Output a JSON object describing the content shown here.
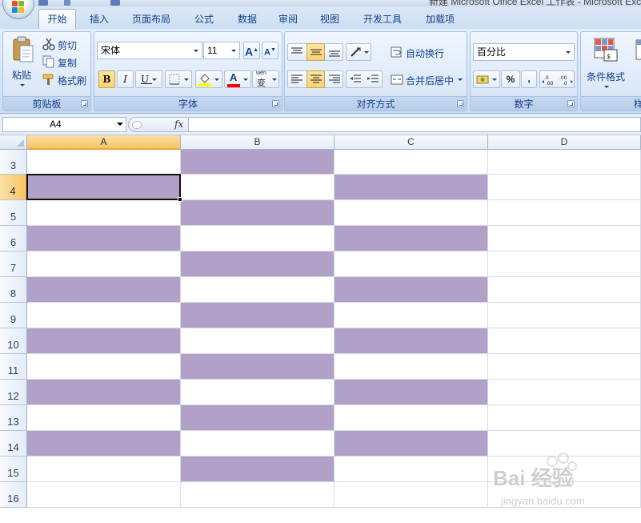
{
  "window": {
    "title": "新建 Microsoft Office Excel 工作表 - Microsoft Excel"
  },
  "tabs": [
    {
      "label": "开始",
      "active": true
    },
    {
      "label": "插入",
      "active": false
    },
    {
      "label": "页面布局",
      "active": false
    },
    {
      "label": "公式",
      "active": false
    },
    {
      "label": "数据",
      "active": false
    },
    {
      "label": "审阅",
      "active": false
    },
    {
      "label": "视图",
      "active": false
    },
    {
      "label": "开发工具",
      "active": false
    },
    {
      "label": "加载项",
      "active": false
    }
  ],
  "clipboard": {
    "paste": "粘贴",
    "cut": "剪切",
    "copy": "复制",
    "format_painter": "格式刷",
    "label": "剪贴板"
  },
  "font": {
    "name": "宋体",
    "size": "11",
    "grow": "A",
    "shrink": "A",
    "bold": "B",
    "italic": "I",
    "underline": "U",
    "font_color_letter": "A",
    "phonetic_letters": "wén",
    "phonetic_char": "变",
    "label": "字体"
  },
  "alignment": {
    "wrap_text": "自动换行",
    "merge_center": "合并后居中",
    "label": "对齐方式"
  },
  "number": {
    "format": "百分比",
    "percent": "%",
    "comma": ",",
    "label": "数字"
  },
  "styles": {
    "conditional": "条件格式",
    "table_partial": "表",
    "group_partial": "样"
  },
  "formula_bar": {
    "name_box": "A4",
    "fx": "fx",
    "value": ""
  },
  "sheet": {
    "columns": [
      "A",
      "B",
      "C",
      "D"
    ],
    "selected_column": "A",
    "selected_row": "4",
    "fill_color": "#b1a0c7",
    "rows": [
      {
        "label": "3",
        "filled": [
          "B"
        ]
      },
      {
        "label": "4",
        "filled": [
          "A",
          "C"
        ]
      },
      {
        "label": "5",
        "filled": [
          "B"
        ]
      },
      {
        "label": "6",
        "filled": [
          "A",
          "C"
        ]
      },
      {
        "label": "7",
        "filled": [
          "B"
        ]
      },
      {
        "label": "8",
        "filled": [
          "A",
          "C"
        ]
      },
      {
        "label": "9",
        "filled": [
          "B"
        ]
      },
      {
        "label": "10",
        "filled": [
          "A",
          "C"
        ]
      },
      {
        "label": "11",
        "filled": [
          "B"
        ]
      },
      {
        "label": "12",
        "filled": [
          "A",
          "C"
        ]
      },
      {
        "label": "13",
        "filled": [
          "B"
        ]
      },
      {
        "label": "14",
        "filled": [
          "A",
          "C"
        ]
      },
      {
        "label": "15",
        "filled": [
          "B"
        ]
      },
      {
        "label": "16",
        "filled": []
      }
    ]
  },
  "watermark": {
    "brand": "Bai  经验",
    "url": "jingyan.baidu.com"
  }
}
